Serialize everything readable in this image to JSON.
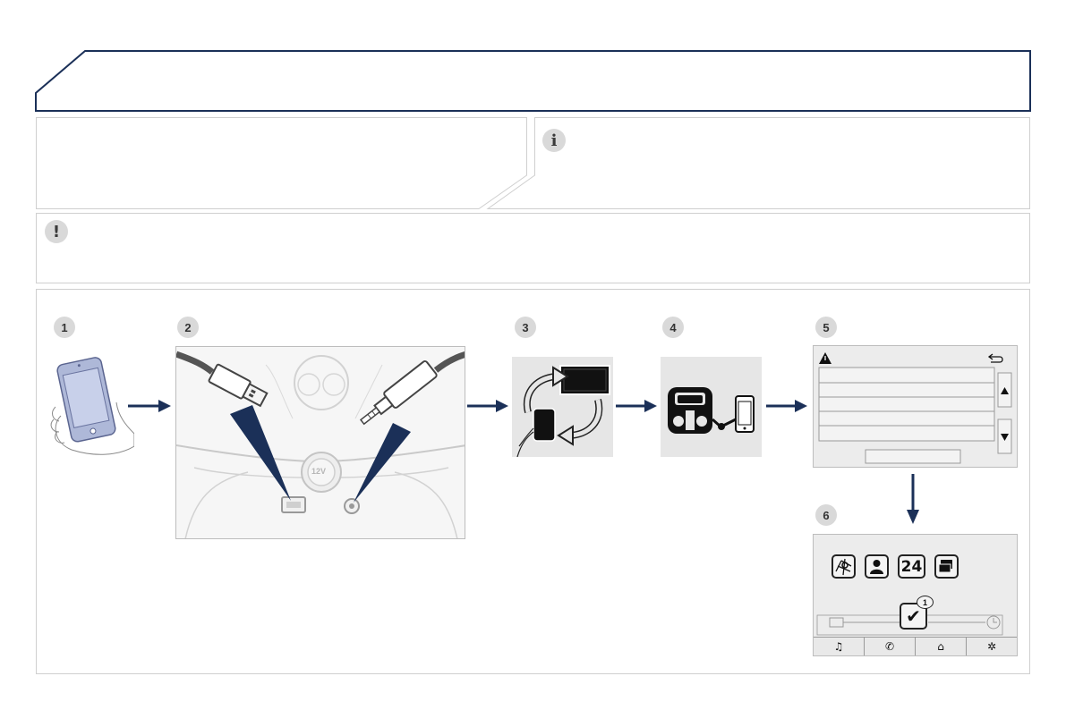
{
  "steps": {
    "s1": "1",
    "s2": "2",
    "s3": "3",
    "s4": "4",
    "s5": "5",
    "s6": "6"
  },
  "icons": {
    "info": "info-icon",
    "warning": "exclamation-icon"
  },
  "colors": {
    "navy": "#1b3058",
    "badge": "#d9d9d9",
    "panel": "#e6e6e6"
  },
  "socket_label": "12V",
  "home_screen": {
    "calendar_label": "24",
    "notification_count": "1",
    "tabs": [
      "music-icon",
      "phone-icon",
      "home-icon",
      "settings-icon"
    ]
  }
}
